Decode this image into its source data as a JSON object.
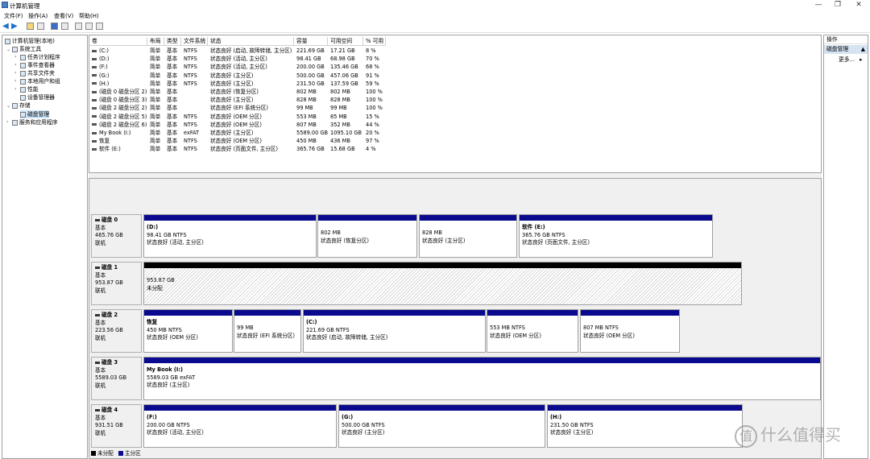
{
  "window": {
    "title": "计算机管理",
    "minimize": "—",
    "maximize": "❐",
    "close": "✕"
  },
  "menu": [
    "文件(F)",
    "操作(A)",
    "查看(V)",
    "帮助(H)"
  ],
  "tree": {
    "root": "计算机管理(本地)",
    "system_tools": "系统工具",
    "task_scheduler": "任务计划程序",
    "event_viewer": "事件查看器",
    "shared_folders": "共享文件夹",
    "local_users": "本地用户和组",
    "performance": "性能",
    "device_manager": "设备管理器",
    "storage": "存储",
    "disk_management": "磁盘管理",
    "services_apps": "服务和应用程序"
  },
  "table": {
    "headers": [
      "卷",
      "布局",
      "类型",
      "文件系统",
      "状态",
      "容量",
      "可用空间",
      "% 可用"
    ],
    "rows": [
      [
        "(C:)",
        "简单",
        "基本",
        "NTFS",
        "状态良好 (启动, 故障转储, 主分区)",
        "221.69 GB",
        "17.21 GB",
        "8 %"
      ],
      [
        "(D:)",
        "简单",
        "基本",
        "NTFS",
        "状态良好 (活动, 主分区)",
        "98.41 GB",
        "68.98 GB",
        "70 %"
      ],
      [
        "(F:)",
        "简单",
        "基本",
        "NTFS",
        "状态良好 (活动, 主分区)",
        "200.00 GB",
        "135.46 GB",
        "68 %"
      ],
      [
        "(G:)",
        "简单",
        "基本",
        "NTFS",
        "状态良好 (主分区)",
        "500.00 GB",
        "457.06 GB",
        "91 %"
      ],
      [
        "(H:)",
        "简单",
        "基本",
        "NTFS",
        "状态良好 (主分区)",
        "231.50 GB",
        "137.59 GB",
        "59 %"
      ],
      [
        "(磁盘 0 磁盘分区 2)",
        "简单",
        "基本",
        "",
        "状态良好 (恢复分区)",
        "802 MB",
        "802 MB",
        "100 %"
      ],
      [
        "(磁盘 0 磁盘分区 3)",
        "简单",
        "基本",
        "",
        "状态良好 (主分区)",
        "828 MB",
        "828 MB",
        "100 %"
      ],
      [
        "(磁盘 2 磁盘分区 2)",
        "简单",
        "基本",
        "",
        "状态良好 (EFI 系统分区)",
        "99 MB",
        "99 MB",
        "100 %"
      ],
      [
        "(磁盘 2 磁盘分区 5)",
        "简单",
        "基本",
        "NTFS",
        "状态良好 (OEM 分区)",
        "553 MB",
        "85 MB",
        "15 %"
      ],
      [
        "(磁盘 2 磁盘分区 6)",
        "简单",
        "基本",
        "NTFS",
        "状态良好 (OEM 分区)",
        "807 MB",
        "352 MB",
        "44 %"
      ],
      [
        "My Book (I:)",
        "简单",
        "基本",
        "exFAT",
        "状态良好 (主分区)",
        "5589.00 GB",
        "1095.10 GB",
        "20 %"
      ],
      [
        "恢复",
        "简单",
        "基本",
        "NTFS",
        "状态良好 (OEM 分区)",
        "450 MB",
        "436 MB",
        "97 %"
      ],
      [
        "软件 (E:)",
        "简单",
        "基本",
        "NTFS",
        "状态良好 (页面文件, 主分区)",
        "365.76 GB",
        "15.68 GB",
        "4 %"
      ]
    ]
  },
  "disks": [
    {
      "name": "磁盘 0",
      "type": "基本",
      "size": "465.76 GB",
      "status": "联机",
      "partitions": [
        {
          "label": "(D:)",
          "size": "98.41 GB NTFS",
          "state": "状态良好 (活动, 主分区)"
        },
        {
          "label": "",
          "size": "802 MB",
          "state": "状态良好 (恢复分区)"
        },
        {
          "label": "",
          "size": "828 MB",
          "state": "状态良好 (主分区)"
        },
        {
          "label": "软件  (E:)",
          "size": "365.76 GB NTFS",
          "state": "状态良好 (页面文件, 主分区)"
        }
      ]
    },
    {
      "name": "磁盘 1",
      "type": "基本",
      "size": "953.87 GB",
      "status": "联机",
      "partitions": [
        {
          "label": "",
          "size": "953.87 GB",
          "state": "未分配"
        }
      ]
    },
    {
      "name": "磁盘 2",
      "type": "基本",
      "size": "223.56 GB",
      "status": "联机",
      "partitions": [
        {
          "label": "恢复",
          "size": "450 MB NTFS",
          "state": "状态良好 (OEM 分区)"
        },
        {
          "label": "",
          "size": "99 MB",
          "state": "状态良好 (EFI 系统分区)"
        },
        {
          "label": "(C:)",
          "size": "221.69 GB NTFS",
          "state": "状态良好 (启动, 故障转储, 主分区)"
        },
        {
          "label": "",
          "size": "553 MB NTFS",
          "state": "状态良好 (OEM 分区)"
        },
        {
          "label": "",
          "size": "807 MB NTFS",
          "state": "状态良好 (OEM 分区)"
        }
      ]
    },
    {
      "name": "磁盘 3",
      "type": "基本",
      "size": "5589.03 GB",
      "status": "联机",
      "partitions": [
        {
          "label": "My Book  (I:)",
          "size": "5589.03 GB exFAT",
          "state": "状态良好 (主分区)"
        }
      ]
    },
    {
      "name": "磁盘 4",
      "type": "基本",
      "size": "931.51 GB",
      "status": "联机",
      "partitions": [
        {
          "label": "(F:)",
          "size": "200.00 GB NTFS",
          "state": "状态良好 (活动, 主分区)"
        },
        {
          "label": "(G:)",
          "size": "500.00 GB NTFS",
          "state": "状态良好 (主分区)"
        },
        {
          "label": "(H:)",
          "size": "231.50 GB NTFS",
          "state": "状态良好 (主分区)"
        }
      ]
    }
  ],
  "legend": {
    "unallocated": "未分配",
    "primary": "主分区"
  },
  "actions": {
    "title": "操作",
    "section": "磁盘管理",
    "more": "更多..."
  },
  "colors": {
    "primary_bar": "#0a0a8f",
    "unallocated_bar": "#000000",
    "selection": "#cce4f7"
  },
  "watermark": "什么值得买"
}
